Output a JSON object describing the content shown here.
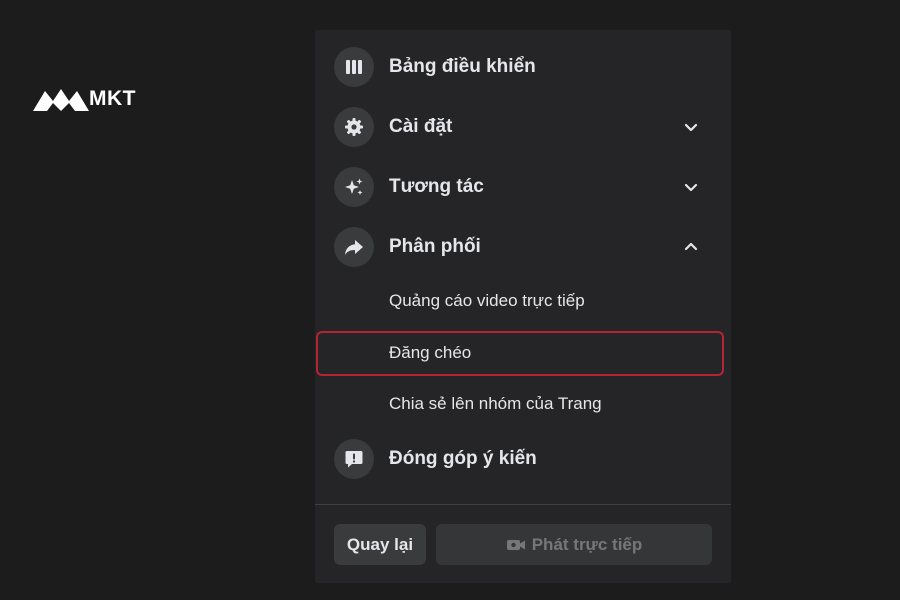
{
  "logo": {
    "text": "MKT"
  },
  "menu": {
    "items": [
      {
        "label": "Bảng điều khiển",
        "icon": "dashboard-icon"
      },
      {
        "label": "Cài đặt",
        "icon": "gear-icon",
        "expanded": false
      },
      {
        "label": "Tương tác",
        "icon": "sparkle-icon",
        "expanded": false
      },
      {
        "label": "Phân phối",
        "icon": "share-arrow-icon",
        "expanded": true
      },
      {
        "label": "Đóng góp ý kiến",
        "icon": "feedback-icon"
      }
    ],
    "distribution_subitems": [
      {
        "label": "Quảng cáo video trực tiếp"
      },
      {
        "label": "Đăng chéo",
        "highlighted": true
      },
      {
        "label": "Chia sẻ lên nhóm của Trang"
      }
    ]
  },
  "footer": {
    "back_label": "Quay lại",
    "go_live_label": "Phát trực tiếp",
    "go_live_icon": "video-camera-icon"
  },
  "colors": {
    "background": "#1c1c1d",
    "panel": "#252527",
    "icon_circle": "#3a3b3c",
    "text": "#e4e6eb",
    "disabled_text": "#75777a",
    "highlight_border": "#b52334"
  }
}
